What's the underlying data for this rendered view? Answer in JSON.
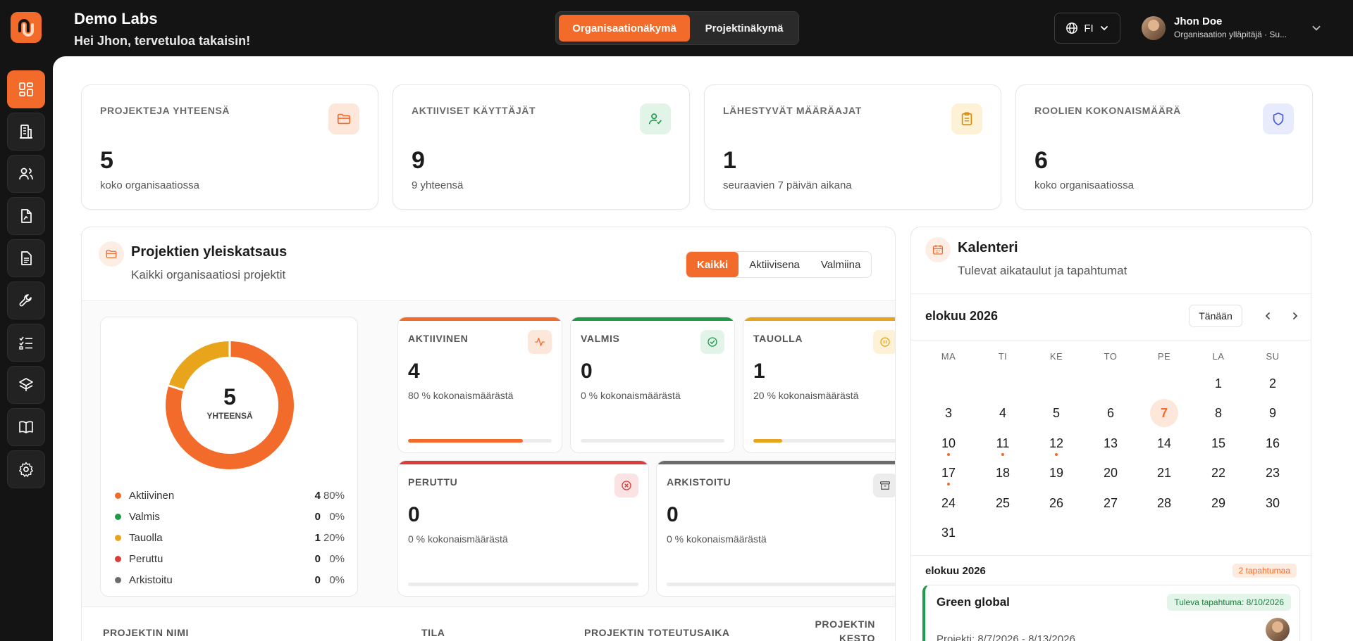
{
  "brand": {
    "title": "Demo Labs",
    "greeting": "Hei Jhon, tervetuloa takaisin!"
  },
  "view_toggle": {
    "org": "Organisaationäkymä",
    "project": "Projektinäkymä"
  },
  "lang": {
    "code": "FI"
  },
  "user": {
    "name": "Jhon Doe",
    "role": "Organisaation ylläpitäjä · Su..."
  },
  "stats": [
    {
      "label": "PROJEKTEJA YHTEENSÄ",
      "value": "5",
      "sub": "koko organisaatiossa"
    },
    {
      "label": "AKTIIVISET KÄYTTÄJÄT",
      "value": "9",
      "sub": "9 yhteensä"
    },
    {
      "label": "LÄHESTYVÄT MÄÄRÄAJAT",
      "value": "1",
      "sub": "seuraavien 7 päivän aikana"
    },
    {
      "label": "ROOLIEN KOKONAISMÄÄRÄ",
      "value": "6",
      "sub": "koko organisaatiossa"
    }
  ],
  "projects": {
    "title": "Projektien yleiskatsaus",
    "subtitle": "Kaikki organisaatiosi projektit",
    "filters": [
      "Kaikki",
      "Aktiivisena",
      "Valmiina"
    ],
    "donut": {
      "total": "5",
      "total_label": "YHTEENSÄ"
    },
    "legend": [
      {
        "name": "Aktiivinen",
        "count": "4",
        "pct": "80%",
        "color": "#f26b2a"
      },
      {
        "name": "Valmis",
        "count": "0",
        "pct": "0%",
        "color": "#1f9a48"
      },
      {
        "name": "Tauolla",
        "count": "1",
        "pct": "20%",
        "color": "#e8a51c"
      },
      {
        "name": "Peruttu",
        "count": "0",
        "pct": "0%",
        "color": "#dc3b3b"
      },
      {
        "name": "Arkistoitu",
        "count": "0",
        "pct": "0%",
        "color": "#6b6b6b"
      }
    ],
    "status_cards": [
      {
        "label": "AKTIIVINEN",
        "value": "4",
        "sub": "80 % kokonaismäärästä",
        "color": "#f26b2a",
        "fraction": 0.8
      },
      {
        "label": "VALMIS",
        "value": "0",
        "sub": "0 % kokonaismäärästä",
        "color": "#1f9a48",
        "fraction": 0
      },
      {
        "label": "TAUOLLA",
        "value": "1",
        "sub": "20 % kokonaismäärästä",
        "color": "#e8a51c",
        "fraction": 0.2
      },
      {
        "label": "PERUTTU",
        "value": "0",
        "sub": "0 % kokonaismäärästä",
        "color": "#dc3b3b",
        "fraction": 0
      },
      {
        "label": "ARKISTOITU",
        "value": "0",
        "sub": "0 % kokonaismäärästä",
        "color": "#6b6b6b",
        "fraction": 0
      }
    ],
    "table_headers": {
      "name": "PROJEKTIN NIMI",
      "status": "TILA",
      "period": "PROJEKTIN TOTEUTUSAIKA",
      "duration_1": "PROJEKTIN",
      "duration_2": "KESTO"
    }
  },
  "calendar": {
    "title": "Kalenteri",
    "subtitle": "Tulevat aikataulut ja tapahtumat",
    "month": "elokuu 2026",
    "today_label": "Tänään",
    "weekdays": [
      "MA",
      "TI",
      "KE",
      "TO",
      "PE",
      "LA",
      "SU"
    ],
    "days": [
      "1",
      "2",
      "3",
      "4",
      "5",
      "6",
      "7",
      "8",
      "9",
      "10",
      "11",
      "12",
      "13",
      "14",
      "15",
      "16",
      "17",
      "18",
      "19",
      "20",
      "21",
      "22",
      "23",
      "24",
      "25",
      "26",
      "27",
      "28",
      "29",
      "30",
      "31"
    ],
    "first_weekday_index": 5,
    "today": 7,
    "event_days": [
      10,
      11,
      12,
      17
    ],
    "events_month": "elokuu 2026",
    "events_count": "2 tapahtumaa",
    "event": {
      "title": "Green global",
      "badge": "Tuleva tapahtuma: 8/10/2026",
      "sub": "Projekti: 8/7/2026 - 8/13/2026"
    }
  },
  "colors": {
    "accent": "#f26b2a",
    "dark": "#141414"
  }
}
